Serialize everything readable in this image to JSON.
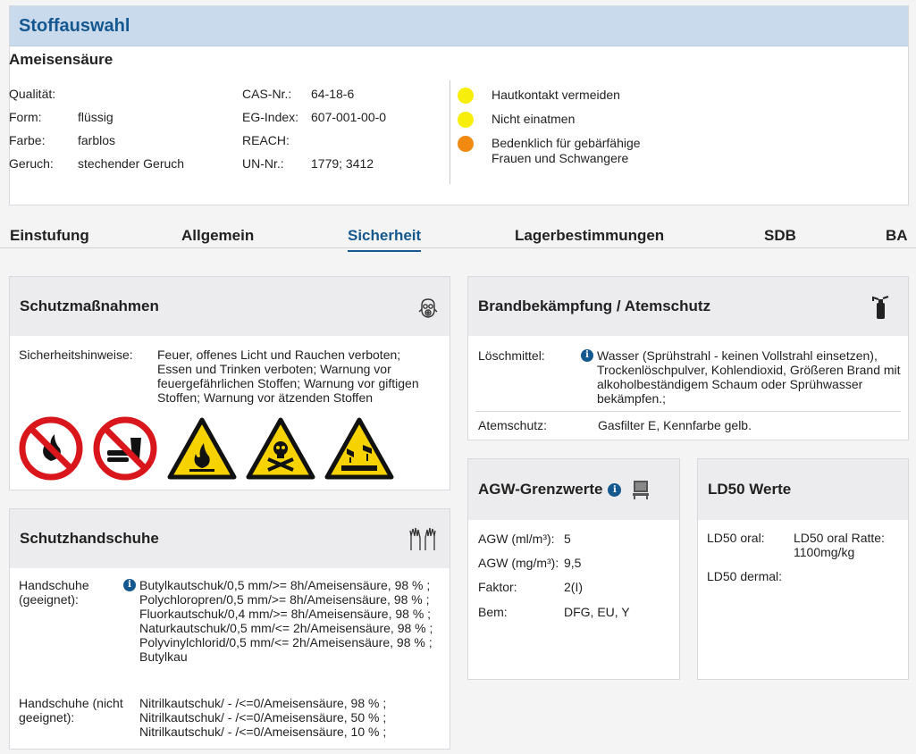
{
  "header": {
    "title": "Stoffauswahl",
    "substance": "Ameisensäure"
  },
  "properties_left": [
    {
      "label": "Qualität:",
      "value": ""
    },
    {
      "label": "Form:",
      "value": "flüssig"
    },
    {
      "label": "Farbe:",
      "value": "farblos"
    },
    {
      "label": "Geruch:",
      "value": "stechender Geruch"
    }
  ],
  "properties_mid": [
    {
      "label": "CAS-Nr.:",
      "value": "64-18-6"
    },
    {
      "label": "EG-Index:",
      "value": "607-001-00-0"
    },
    {
      "label": "REACH:",
      "value": ""
    },
    {
      "label": "UN-Nr.:",
      "value": "1779; 3412"
    }
  ],
  "hazards": [
    {
      "text": "Hautkontakt vermeiden",
      "color": "#f7ee0c"
    },
    {
      "text": "Nicht einatmen",
      "color": "#f7ee0c"
    },
    {
      "text": "Bedenklich für gebärfähige Frauen und Schwangere",
      "color": "#f28a12"
    }
  ],
  "tabs": [
    "Einstufung",
    "Allgemein",
    "Sicherheit",
    "Lagerbestimmungen",
    "SDB",
    "BA"
  ],
  "active_tab": "Sicherheit",
  "schutzmassnahmen": {
    "title": "Schutzmaßnahmen",
    "label": "Sicherheitshinweise:",
    "text": "Feuer, offenes Licht und Rauchen verboten; Essen und Trinken verboten; Warnung vor feuergefährlichen Stoffen; Warnung vor giftigen Stoffen; Warnung vor ätzenden Stoffen",
    "signs": [
      "no-fire-sign",
      "no-eating-sign",
      "flammable-warning-sign",
      "toxic-warning-sign",
      "corrosive-warning-sign"
    ]
  },
  "schutzhandschuhe": {
    "title": "Schutzhandschuhe",
    "suitable_label": "Handschuhe (geeignet):",
    "suitable_text": "Butylkautschuk/0,5 mm/>= 8h/Ameisensäure, 98 % ; Polychloropren/0,5 mm/>= 8h/Ameisensäure, 98 % ; Fluorkautschuk/0,4 mm/>= 8h/Ameisensäure, 98 % ; Naturkautschuk/0,5 mm/<= 2h/Ameisensäure, 98 % ; Polyvinylchlorid/0,5 mm/<= 2h/Ameisensäure, 98 % ; Butylkau",
    "unsuitable_label": "Handschuhe (nicht geeignet):",
    "unsuitable_text": "Nitrilkautschuk/ - /<=0/Ameisensäure, 98 % ; Nitrilkautschuk/ - /<=0/Ameisensäure, 50 % ; Nitrilkautschuk/ - /<=0/Ameisensäure, 10 % ;"
  },
  "brand": {
    "title": "Brandbekämpfung / Atemschutz",
    "loesch_label": "Löschmittel:",
    "loesch_text": "Wasser (Sprühstrahl - keinen Vollstrahl einsetzen), Trockenlöschpulver, Kohlendioxid, Größeren Brand mit alkoholbeständigem Schaum oder Sprühwasser bekämpfen.;",
    "atem_label": "Atemschutz:",
    "atem_text": "Gasfilter E, Kennfarbe gelb."
  },
  "agw": {
    "title": "AGW-Grenzwerte",
    "rows": [
      {
        "label": "AGW (ml/m³):",
        "value": "5"
      },
      {
        "label": "AGW (mg/m³):",
        "value": "9,5"
      },
      {
        "label": "Faktor:",
        "value": "2(I)"
      },
      {
        "label": "Bem:",
        "value": "DFG, EU, Y"
      }
    ]
  },
  "ld50": {
    "title": "LD50 Werte",
    "oral_label": "LD50 oral:",
    "oral_value": "LD50 oral Ratte: 1100mg/kg",
    "dermal_label": "LD50 dermal:",
    "dermal_value": ""
  }
}
